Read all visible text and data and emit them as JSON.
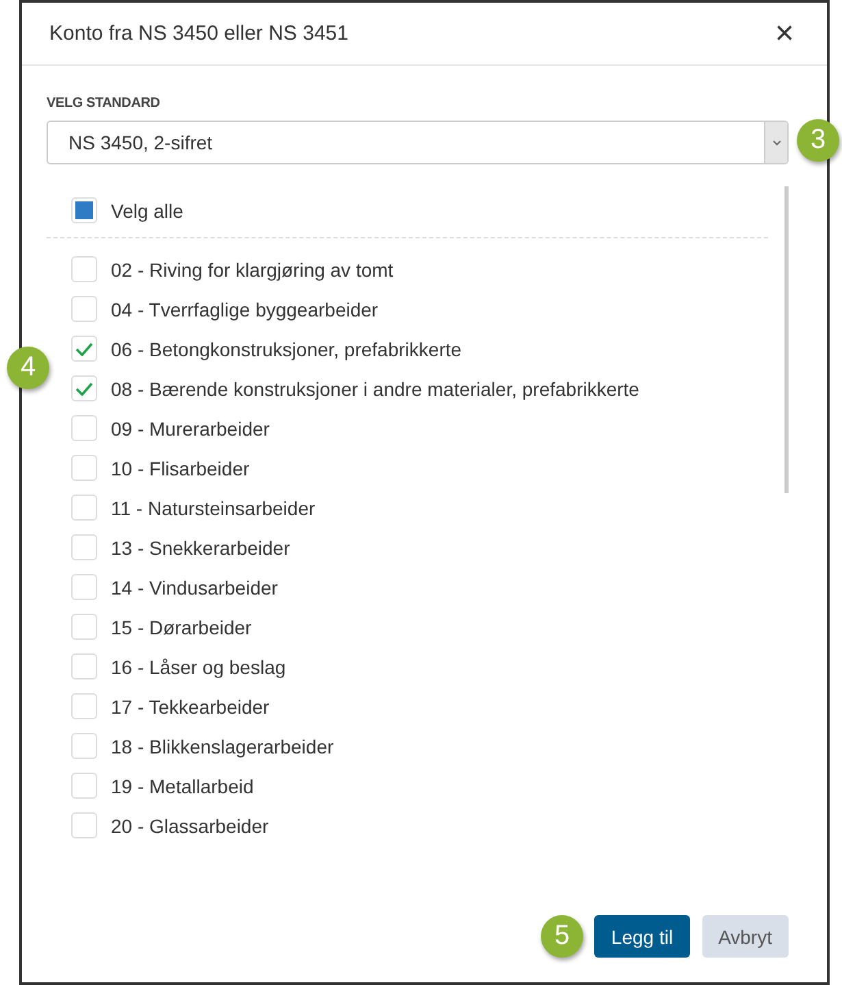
{
  "dialog": {
    "title": "Konto fra NS 3450 eller NS 3451",
    "close": "×"
  },
  "standard": {
    "label": "VELG STANDARD",
    "value": "NS 3450, 2-sifret"
  },
  "select_all": {
    "label": "Velg alle",
    "partial": true
  },
  "accounts": [
    {
      "label": "02 - Riving for klargjøring av tomt",
      "checked": false
    },
    {
      "label": "04 - Tverrfaglige byggearbeider",
      "checked": false
    },
    {
      "label": "06 - Betongkonstruksjoner, prefabrikkerte",
      "checked": true
    },
    {
      "label": "08 - Bærende konstruksjoner i andre materialer, prefabrikkerte",
      "checked": true
    },
    {
      "label": "09 - Murerarbeider",
      "checked": false
    },
    {
      "label": "10 - Flisarbeider",
      "checked": false
    },
    {
      "label": "11 - Natursteinsarbeider",
      "checked": false
    },
    {
      "label": "13 - Snekkerarbeider",
      "checked": false
    },
    {
      "label": "14 - Vindusarbeider",
      "checked": false
    },
    {
      "label": "15 - Dørarbeider",
      "checked": false
    },
    {
      "label": "16 - Låser og beslag",
      "checked": false
    },
    {
      "label": "17 - Tekkearbeider",
      "checked": false
    },
    {
      "label": "18 - Blikkenslagerarbeider",
      "checked": false
    },
    {
      "label": "19 - Metallarbeid",
      "checked": false
    },
    {
      "label": "20 - Glassarbeider",
      "checked": false
    }
  ],
  "buttons": [
    {
      "label": "Legg til",
      "kind": "primary"
    },
    {
      "label": "Avbryt",
      "kind": "secondary"
    }
  ],
  "callouts": [
    {
      "label": "3"
    },
    {
      "label": "4"
    },
    {
      "label": "5"
    }
  ]
}
